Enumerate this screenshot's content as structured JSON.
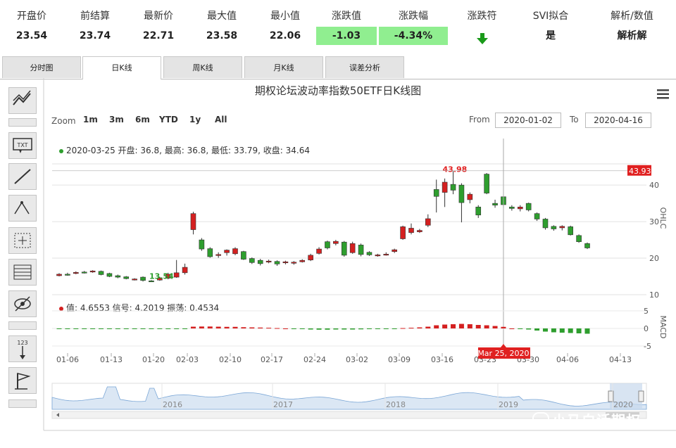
{
  "quote": {
    "columns": [
      {
        "label": "开盘价",
        "value": "23.54",
        "highlight": false
      },
      {
        "label": "前结算",
        "value": "23.74",
        "highlight": false
      },
      {
        "label": "最新价",
        "value": "22.71",
        "highlight": false
      },
      {
        "label": "最大值",
        "value": "23.58",
        "highlight": false
      },
      {
        "label": "最小值",
        "value": "22.06",
        "highlight": false
      },
      {
        "label": "涨跌值",
        "value": "-1.03",
        "highlight": true
      },
      {
        "label": "涨跌幅",
        "value": "-4.34%",
        "highlight": true
      },
      {
        "label": "涨跌符",
        "value": "",
        "highlight": false
      },
      {
        "label": "SVI拟合",
        "value": "是",
        "highlight": false
      },
      {
        "label": "解析/数值",
        "value": "解析解",
        "highlight": false
      }
    ],
    "trend_icon": "arrow-down-icon",
    "trend_color": "#1a9a1a"
  },
  "tabs": [
    {
      "label": "分时图",
      "active": false
    },
    {
      "label": "日K线",
      "active": true
    },
    {
      "label": "周K线",
      "active": false
    },
    {
      "label": "月K线",
      "active": false
    },
    {
      "label": "误差分析",
      "active": false
    }
  ],
  "toolbar": {
    "icons": [
      "trendline-icon",
      "text-annotation-icon",
      "line-icon",
      "measure-icon",
      "crosshair-icon",
      "grid-icon",
      "hide-icon",
      "number-arrow-icon",
      "flag-icon"
    ],
    "txt_label": "TXT",
    "num_label": "123"
  },
  "zoom": {
    "label": "Zoom",
    "buttons": [
      "1m",
      "3m",
      "6m",
      "YTD",
      "1y",
      "All"
    ]
  },
  "range": {
    "from_label": "From",
    "from_value": "2020-01-02",
    "to_label": "To",
    "to_value": "2020-04-16"
  },
  "ohlc_info": "2020-03-25 开盘: 36.8, 最高: 36.8, 最低: 33.79, 收盘: 34.64",
  "macd_info": "值: 4.6553 信号: 4.2019 振荡: 0.4534",
  "watermark": "小马白话期权",
  "colors": {
    "up": "#d42020",
    "down": "#2e9e2e",
    "crosshair": "#aaaaaa",
    "price_label_bg": "#e02020"
  },
  "chart_data": {
    "type": "candlestick",
    "title": "期权论坛波动率指数50ETF日K线图",
    "y_axis_label": "OHLC",
    "y_ticks": [
      10,
      20,
      30,
      40
    ],
    "ylim": [
      10,
      46
    ],
    "x_tick_labels": [
      "01-06",
      "01-13",
      "01-20",
      "02-03",
      "02-10",
      "02-17",
      "02-24",
      "03-02",
      "03-09",
      "03-16",
      "03-23",
      "03-30",
      "04-06",
      "04-13"
    ],
    "current_price_label": "43.93",
    "max_label": "43.98",
    "min_label": "13.54",
    "crosshair_label": "Mar 25, 2020",
    "navigator_years": [
      "2016",
      "2017",
      "2018",
      "2019",
      "2020"
    ],
    "candles": [
      {
        "open": 15.2,
        "close": 15.6,
        "high": 15.9,
        "low": 15.0
      },
      {
        "open": 15.6,
        "close": 15.5,
        "high": 16.0,
        "low": 15.2
      },
      {
        "open": 15.8,
        "close": 16.1,
        "high": 16.4,
        "low": 15.6
      },
      {
        "open": 16.2,
        "close": 16.0,
        "high": 16.5,
        "low": 15.8
      },
      {
        "open": 16.2,
        "close": 16.5,
        "high": 16.7,
        "low": 16.0
      },
      {
        "open": 16.4,
        "close": 15.5,
        "high": 16.6,
        "low": 15.3
      },
      {
        "open": 15.8,
        "close": 15.0,
        "high": 16.0,
        "low": 14.8
      },
      {
        "open": 15.2,
        "close": 14.8,
        "high": 15.5,
        "low": 14.5
      },
      {
        "open": 14.9,
        "close": 14.4,
        "high": 15.1,
        "low": 14.2
      },
      {
        "open": 14.2,
        "close": 14.3,
        "high": 14.5,
        "low": 13.9
      },
      {
        "open": 14.8,
        "close": 13.9,
        "high": 15.0,
        "low": 13.6
      },
      {
        "open": 13.8,
        "close": 13.7,
        "high": 14.0,
        "low": 13.54
      },
      {
        "open": 14.0,
        "close": 14.6,
        "high": 14.9,
        "low": 13.8
      },
      {
        "open": 14.5,
        "close": 15.6,
        "high": 16.0,
        "low": 14.2
      },
      {
        "open": 14.8,
        "close": 16.0,
        "high": 19.5,
        "low": 14.6
      },
      {
        "open": 16.0,
        "close": 17.5,
        "high": 18.5,
        "low": 15.5
      },
      {
        "open": 27.8,
        "close": 32.2,
        "high": 32.7,
        "low": 26.5
      },
      {
        "open": 25.0,
        "close": 22.5,
        "high": 25.5,
        "low": 22.0
      },
      {
        "open": 22.6,
        "close": 20.4,
        "high": 23.0,
        "low": 20.1
      },
      {
        "open": 21.0,
        "close": 21.0,
        "high": 21.6,
        "low": 20.1
      },
      {
        "open": 21.5,
        "close": 22.2,
        "high": 22.4,
        "low": 20.7
      },
      {
        "open": 21.2,
        "close": 22.6,
        "high": 23.0,
        "low": 20.8
      },
      {
        "open": 21.8,
        "close": 19.7,
        "high": 22.0,
        "low": 19.5
      },
      {
        "open": 19.9,
        "close": 18.8,
        "high": 20.2,
        "low": 18.4
      },
      {
        "open": 19.4,
        "close": 18.5,
        "high": 19.8,
        "low": 18.0
      },
      {
        "open": 19.0,
        "close": 19.2,
        "high": 19.6,
        "low": 18.6
      },
      {
        "open": 19.1,
        "close": 18.4,
        "high": 19.4,
        "low": 17.9
      },
      {
        "open": 18.8,
        "close": 19.0,
        "high": 19.3,
        "low": 18.3
      },
      {
        "open": 18.6,
        "close": 18.9,
        "high": 19.2,
        "low": 18.2
      },
      {
        "open": 19.0,
        "close": 19.4,
        "high": 19.7,
        "low": 18.8
      },
      {
        "open": 19.5,
        "close": 20.8,
        "high": 21.2,
        "low": 19.2
      },
      {
        "open": 21.3,
        "close": 22.5,
        "high": 23.0,
        "low": 21.0
      },
      {
        "open": 24.5,
        "close": 22.8,
        "high": 24.8,
        "low": 22.4
      },
      {
        "open": 24.0,
        "close": 24.6,
        "high": 25.0,
        "low": 23.5
      },
      {
        "open": 24.4,
        "close": 20.8,
        "high": 24.7,
        "low": 20.4
      },
      {
        "open": 21.5,
        "close": 24.0,
        "high": 24.5,
        "low": 21.2
      },
      {
        "open": 23.6,
        "close": 21.0,
        "high": 24.0,
        "low": 20.5
      },
      {
        "open": 21.6,
        "close": 20.9,
        "high": 21.9,
        "low": 20.6
      },
      {
        "open": 20.7,
        "close": 20.9,
        "high": 21.2,
        "low": 20.4
      },
      {
        "open": 20.9,
        "close": 21.1,
        "high": 21.6,
        "low": 20.7
      },
      {
        "open": 21.8,
        "close": 22.3,
        "high": 22.6,
        "low": 21.4
      },
      {
        "open": 25.3,
        "close": 28.6,
        "high": 28.9,
        "low": 25.0
      },
      {
        "open": 27.0,
        "close": 28.2,
        "high": 29.5,
        "low": 26.5
      },
      {
        "open": 27.2,
        "close": 27.6,
        "high": 28.0,
        "low": 26.9
      },
      {
        "open": 29.0,
        "close": 30.8,
        "high": 32.0,
        "low": 28.5
      },
      {
        "open": 38.8,
        "close": 36.9,
        "high": 41.5,
        "low": 32.5
      },
      {
        "open": 38.0,
        "close": 40.8,
        "high": 41.8,
        "low": 34.0
      },
      {
        "open": 40.2,
        "close": 38.6,
        "high": 43.98,
        "low": 37.5
      },
      {
        "open": 40.0,
        "close": 35.2,
        "high": 40.5,
        "low": 29.8
      },
      {
        "open": 36.0,
        "close": 37.5,
        "high": 38.0,
        "low": 35.0
      },
      {
        "open": 34.0,
        "close": 31.8,
        "high": 34.5,
        "low": 31.0
      },
      {
        "open": 43.0,
        "close": 37.8,
        "high": 43.3,
        "low": 37.5
      },
      {
        "open": 35.0,
        "close": 34.5,
        "high": 36.0,
        "low": 33.8
      },
      {
        "open": 36.8,
        "close": 34.64,
        "high": 36.8,
        "low": 33.79
      },
      {
        "open": 34.0,
        "close": 33.6,
        "high": 34.5,
        "low": 33.0
      },
      {
        "open": 33.5,
        "close": 34.0,
        "high": 34.5,
        "low": 32.8
      },
      {
        "open": 35.0,
        "close": 33.2,
        "high": 35.2,
        "low": 32.8
      },
      {
        "open": 32.2,
        "close": 30.7,
        "high": 32.5,
        "low": 30.2
      },
      {
        "open": 30.7,
        "close": 28.3,
        "high": 31.0,
        "low": 27.8
      },
      {
        "open": 28.7,
        "close": 28.0,
        "high": 29.0,
        "low": 27.5
      },
      {
        "open": 28.3,
        "close": 28.7,
        "high": 29.0,
        "low": 27.6
      },
      {
        "open": 28.6,
        "close": 26.4,
        "high": 28.9,
        "low": 26.2
      },
      {
        "open": 26.2,
        "close": 24.5,
        "high": 26.5,
        "low": 24.2
      },
      {
        "open": 24.0,
        "close": 22.8,
        "high": 24.3,
        "low": 22.5
      }
    ],
    "macd": {
      "y_ticks": [
        5,
        0,
        -5
      ],
      "ylim": [
        -7,
        7
      ],
      "ylabel": "MACD",
      "histogram": [
        -0.15,
        -0.15,
        -0.15,
        -0.15,
        -0.15,
        -0.15,
        -0.15,
        -0.15,
        -0.15,
        -0.15,
        -0.15,
        -0.15,
        -0.2,
        -0.2,
        -0.2,
        -0.2,
        0.5,
        0.55,
        0.55,
        0.5,
        0.45,
        0.45,
        0.35,
        0.3,
        0.25,
        0.2,
        0.1,
        0.0,
        -0.1,
        -0.2,
        -0.3,
        -0.35,
        -0.35,
        -0.3,
        -0.3,
        -0.3,
        -0.25,
        -0.2,
        -0.15,
        -0.1,
        -0.1,
        0.1,
        0.2,
        0.3,
        0.5,
        0.9,
        1.1,
        1.2,
        1.3,
        1.2,
        1.0,
        0.9,
        0.7,
        0.45,
        0.0,
        -0.1,
        -0.3,
        -0.6,
        -0.9,
        -1.1,
        -1.2,
        -1.3,
        -1.4,
        -1.5
      ]
    }
  }
}
